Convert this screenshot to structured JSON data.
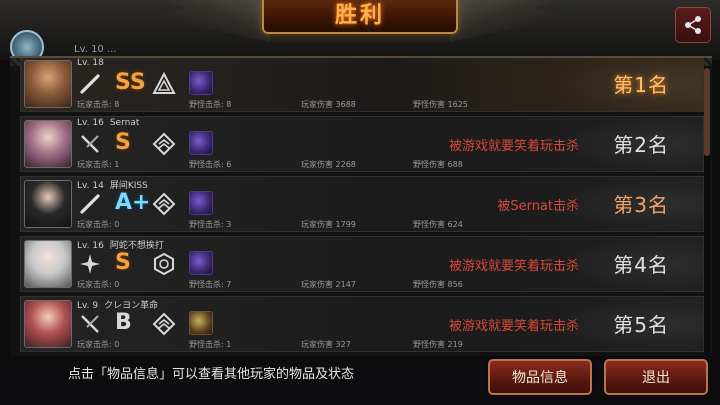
{
  "header": {
    "title": "胜利"
  },
  "top_partial_text": "Lv. 10  ...",
  "players": [
    {
      "level": "Lv. 18",
      "name": "",
      "grade": "SS",
      "grade_class": "ss",
      "player_kills_label": "玩家击杀: 8",
      "monster_kills_label": "野怪击杀: 8",
      "player_damage_label": "玩家伤害 3688",
      "monster_damage_label": "野怪伤害 1625",
      "killed_by": "",
      "rank": "第1名",
      "rank_class": "gold",
      "weapon_icon": "bat-icon",
      "armor_icon": "triangle-armor-icon",
      "item_icon": "beast-item-icon"
    },
    {
      "level": "Lv. 16",
      "name": "Sernat",
      "grade": "S",
      "grade_class": "s",
      "player_kills_label": "玩家击杀: 1",
      "monster_kills_label": "野怪击杀: 6",
      "player_damage_label": "玩家伤害 2268",
      "monster_damage_label": "野怪伤害 688",
      "killed_by": "被游戏就要笑着玩击杀",
      "rank": "第2名",
      "rank_class": "",
      "weapon_icon": "crossed-blades-icon",
      "armor_icon": "chevron-armor-icon",
      "item_icon": "beast-item-icon"
    },
    {
      "level": "Lv. 14",
      "name": "屏间KISS",
      "grade": "A+",
      "grade_class": "ap",
      "player_kills_label": "玩家击杀: 0",
      "monster_kills_label": "野怪击杀: 3",
      "player_damage_label": "玩家伤害 1799",
      "monster_damage_label": "野怪伤害 624",
      "killed_by": "被Sernat击杀",
      "rank": "第3名",
      "rank_class": "bronze",
      "weapon_icon": "bat-icon",
      "armor_icon": "chevron-armor-icon",
      "item_icon": "beast-item-icon"
    },
    {
      "level": "Lv. 16",
      "name": "阿蛇不想挨打",
      "grade": "S",
      "grade_class": "s",
      "player_kills_label": "玩家击杀: 0",
      "monster_kills_label": "野怪击杀: 7",
      "player_damage_label": "玩家伤害 2147",
      "monster_damage_label": "野怪伤害 856",
      "killed_by": "被游戏就要笑着玩击杀",
      "rank": "第4名",
      "rank_class": "",
      "weapon_icon": "shuriken-icon",
      "armor_icon": "hexagon-armor-icon",
      "item_icon": "beast-item-icon"
    },
    {
      "level": "Lv. 9",
      "name": "クレヨン革命",
      "grade": "B",
      "grade_class": "b",
      "player_kills_label": "玩家击杀: 0",
      "monster_kills_label": "野怪击杀: 1",
      "player_damage_label": "玩家伤害 327",
      "monster_damage_label": "野怪伤害 219",
      "killed_by": "被游戏就要笑着玩击杀",
      "rank": "第5名",
      "rank_class": "",
      "weapon_icon": "crossed-blades-icon",
      "armor_icon": "chevron-armor-icon",
      "item_icon": "golden-item-icon"
    }
  ],
  "footer": {
    "hint": "点击「物品信息」可以查看其他玩家的物品及状态",
    "items_button": "物品信息",
    "exit_button": "退出"
  },
  "colors": {
    "accent": "#ffb04a",
    "killed_by": "#d9483a",
    "button_bg": "#8a2a1e"
  }
}
